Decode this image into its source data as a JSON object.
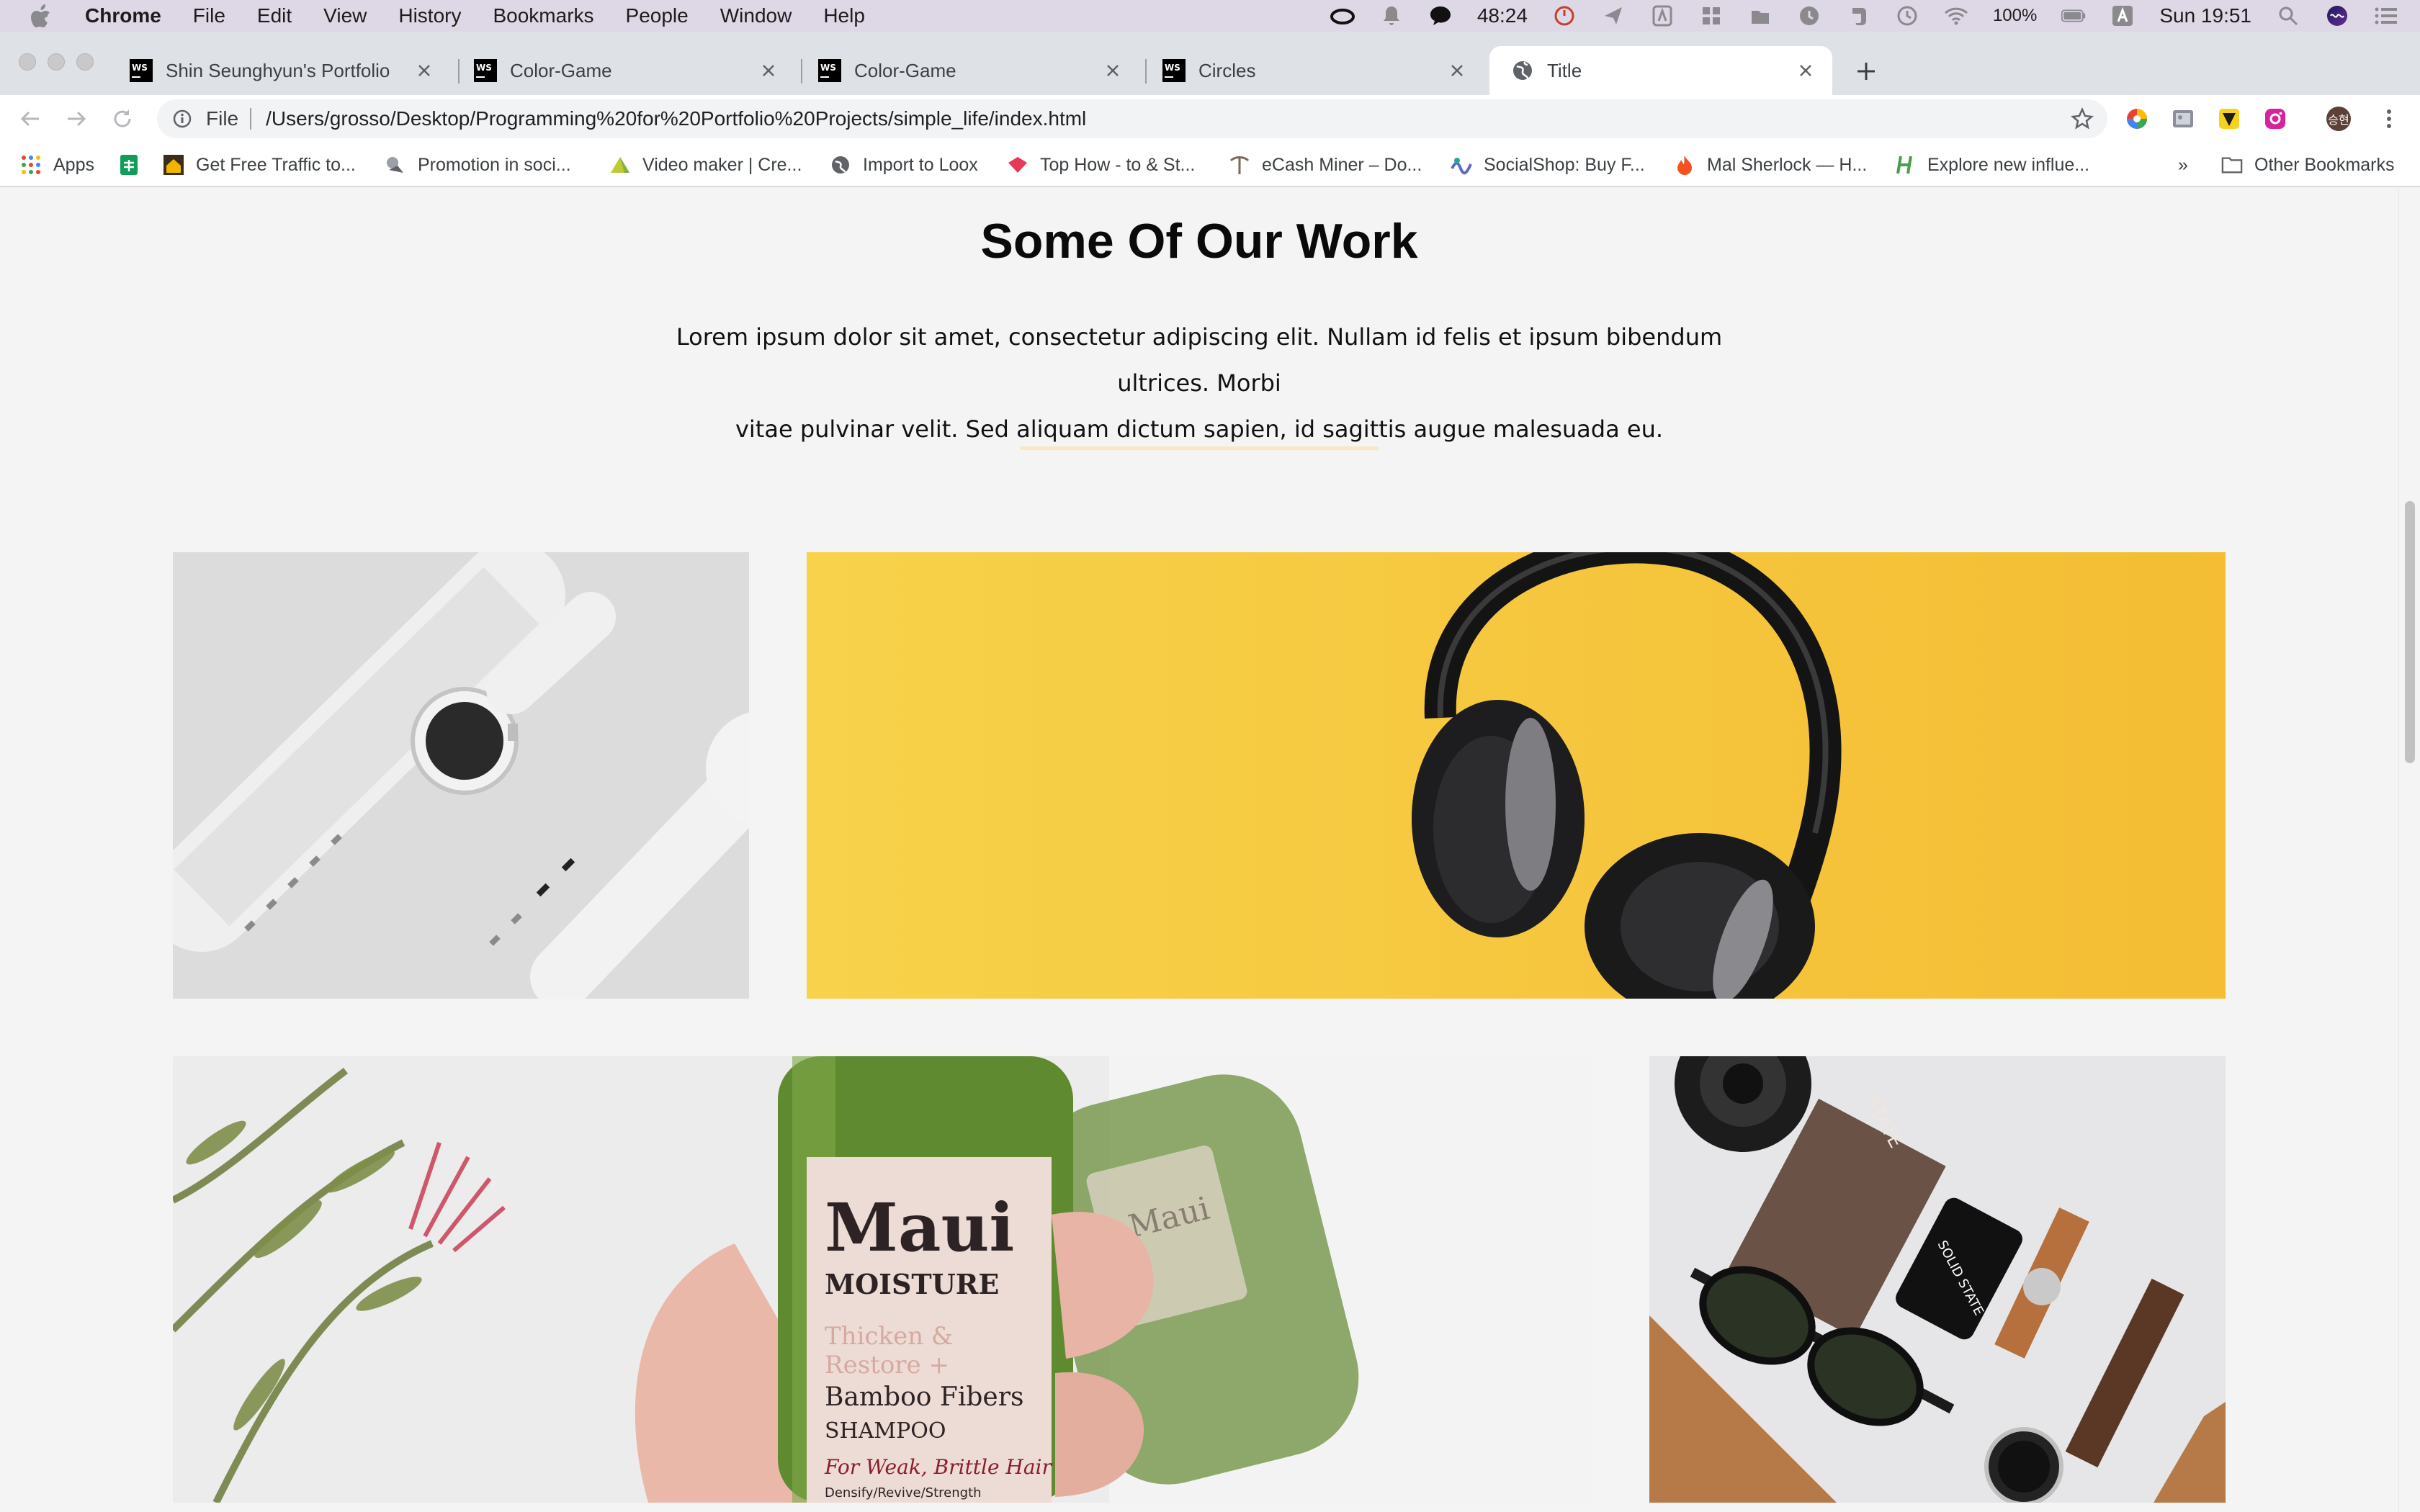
{
  "menubar": {
    "app": "Chrome",
    "items": [
      "File",
      "Edit",
      "View",
      "History",
      "Bookmarks",
      "People",
      "Window",
      "Help"
    ],
    "timer": "48:24",
    "battery": "100%",
    "clock": "Sun 19:51"
  },
  "tabs": [
    {
      "title": "Shin Seunghyun's Portfolio",
      "icon": "webstorm-icon",
      "active": false
    },
    {
      "title": "Color-Game",
      "icon": "webstorm-icon",
      "active": false
    },
    {
      "title": "Color-Game",
      "icon": "webstorm-icon",
      "active": false
    },
    {
      "title": "Circles",
      "icon": "webstorm-icon",
      "active": false
    },
    {
      "title": "Title",
      "icon": "globe-icon",
      "active": true
    }
  ],
  "toolbar": {
    "scheme": "File",
    "url": "/Users/grosso/Desktop/Programming%20for%20Portfolio%20Projects/simple_life/index.html",
    "profile_initials": "승현"
  },
  "bookmarks": {
    "items": [
      "Apps",
      "Get Free Traffic to...",
      "Promotion in soci...",
      "Video maker | Cre...",
      "Import to Loox",
      "Top How - to & St...",
      "eCash Miner – Do...",
      "SocialShop: Buy F...",
      "Mal Sherlock — H...",
      "Explore new influe..."
    ],
    "overflow": "»",
    "other": "Other Bookmarks"
  },
  "page": {
    "title": "Some Of Our Work",
    "description_line1": "Lorem ipsum dolor sit amet, consectetur adipiscing elit. Nullam id felis et ipsum bibendum ultrices. Morbi",
    "description_line2": "vitae pulvinar velit. Sed aliquam dictum sapien, id sagittis augue malesuada eu.",
    "accent_color": "#fbe7c6",
    "gallery": {
      "bottle_brand": "Maui",
      "bottle_sub": "MOISTURE",
      "bottle_line1": "Thicken &",
      "bottle_line2": "Restore +",
      "bottle_line3": "Bamboo Fibers",
      "bottle_line4": "SHAMPOO",
      "bottle_line5": "For Weak, Brittle Hair",
      "bottle_line6": "Densify/Revive/Strength",
      "bottle_back_brand": "Maui",
      "box_label": "STATE",
      "phone_label": "SOLID STATE"
    }
  },
  "colors": {
    "menubar_bg": "#ded7e6",
    "tabstrip_bg": "#dee1e6",
    "page_bg": "#f4f4f4",
    "headphones_bg": "#f6c53a"
  }
}
